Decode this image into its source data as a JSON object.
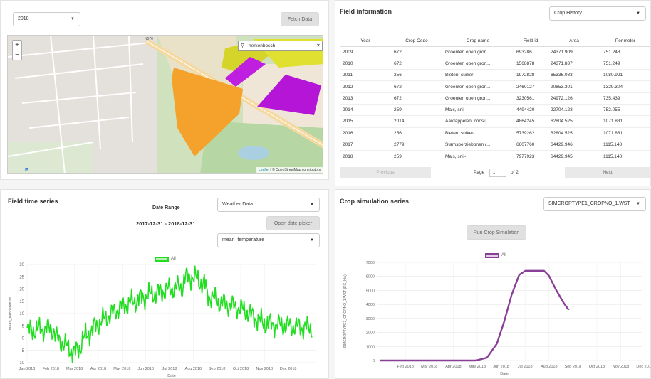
{
  "year_select": {
    "value": "2018"
  },
  "fetch_button": {
    "label": "Fetch Data"
  },
  "map": {
    "search_value": "herkenbosch",
    "road_label": "N570",
    "attribution_leaflet": "Leaflet",
    "attribution_rest": " | © OpenStreetMap contributors"
  },
  "field_info": {
    "title": "Field information",
    "history_select": "Crop History",
    "columns": [
      "Year",
      "Crop Code",
      "Crop name",
      "Field id",
      "Area",
      "Perimeter"
    ],
    "rows": [
      [
        "2009",
        "672",
        "Groenten open gron...",
        "693286",
        "24371.909",
        "751.248"
      ],
      [
        "2010",
        "672",
        "Groenten open gron...",
        "1568878",
        "24371.837",
        "751.249"
      ],
      [
        "2011",
        "256",
        "Bieten, suiker-",
        "1972828",
        "65336.083",
        "1080.921"
      ],
      [
        "2012",
        "672",
        "Groenten open gron...",
        "2460127",
        "90853.301",
        "1329.304"
      ],
      [
        "2013",
        "672",
        "Groenten open gron...",
        "3230561",
        "24972.126",
        "735.439"
      ],
      [
        "2014",
        "259",
        "Mais, snij-",
        "4494420",
        "22704.123",
        "752.055"
      ],
      [
        "2015",
        "2014",
        "Aardappelen, consu...",
        "4864245",
        "62804.525",
        "1071.831"
      ],
      [
        "2016",
        "256",
        "Bieten, suiker-",
        "5739262",
        "62804.525",
        "1071.831"
      ],
      [
        "2017",
        "2779",
        "Stamsperziebonen (...",
        "6607760",
        "64429.946",
        "1115.148"
      ],
      [
        "2018",
        "259",
        "Mais, snij-",
        "7977923",
        "64429.945",
        "1115.148"
      ]
    ],
    "prev_label": "Previous",
    "next_label": "Next",
    "page_label": "Page",
    "page_value": "1",
    "of_label": "of 2"
  },
  "field_ts": {
    "title": "Field time series",
    "date_range_label": "Date Range",
    "date_range_value": "2017-12-31 - 2018-12-31",
    "weather_select": "Weather Data",
    "open_picker_label": "Open date picker",
    "variable_select": "mean_temperature"
  },
  "crop_sim": {
    "title": "Crop simulation series",
    "file_select": "SIMCROPTYPE1_CROPNO_1.WST",
    "run_button": "Run Crop Simulation"
  },
  "colors": {
    "temperature": "#22dd22",
    "simulation": "#8a3f96",
    "accent": "#2266aa"
  },
  "chart_data": [
    {
      "type": "line",
      "series": [
        {
          "name": "All"
        }
      ],
      "xlabel": "Date",
      "ylabel": "mean_temperature",
      "ylim": [
        -10,
        30
      ],
      "yticks": [
        "30",
        "25",
        "20",
        "15",
        "10",
        "5",
        "0",
        "-5",
        "-10"
      ],
      "xticks": [
        "Jan 2018",
        "Feb 2018",
        "Mar 2018",
        "Apr 2018",
        "May 2018",
        "Jun 2018",
        "Jul 2018",
        "Aug 2018",
        "Sep 2018",
        "Oct 2018",
        "Nov 2018",
        "Dec 2018"
      ],
      "month_keypoints": [
        3,
        4,
        -4,
        6,
        13,
        17,
        20,
        22,
        15,
        12,
        6,
        5
      ],
      "grid": true,
      "legend": "top"
    },
    {
      "type": "line",
      "series": [
        {
          "name": "All"
        }
      ],
      "xlabel": "Date",
      "ylabel": "SIMCROPTYPE1_CROPNO_1.WST (KG_HA)",
      "ylim": [
        0,
        7000
      ],
      "yticks": [
        "7000",
        "6000",
        "5000",
        "4000",
        "3000",
        "2000",
        "1000",
        "0"
      ],
      "xticks": [
        "Feb 2018",
        "Mar 2018",
        "Apr 2018",
        "May 2018",
        "Jun 2018",
        "Jul 2018",
        "Aug 2018",
        "Sep 2018",
        "Oct 2018",
        "Nov 2018",
        "Dec 2018"
      ],
      "points": [
        [
          0,
          0
        ],
        [
          3.85,
          0
        ],
        [
          4.3,
          200
        ],
        [
          4.7,
          1200
        ],
        [
          5.0,
          2800
        ],
        [
          5.3,
          4700
        ],
        [
          5.6,
          6100
        ],
        [
          5.85,
          6400
        ],
        [
          6.6,
          6400
        ],
        [
          6.8,
          6050
        ],
        [
          7.1,
          5000
        ],
        [
          7.4,
          4100
        ],
        [
          7.6,
          3600
        ]
      ],
      "grid": true,
      "legend": "top"
    }
  ]
}
